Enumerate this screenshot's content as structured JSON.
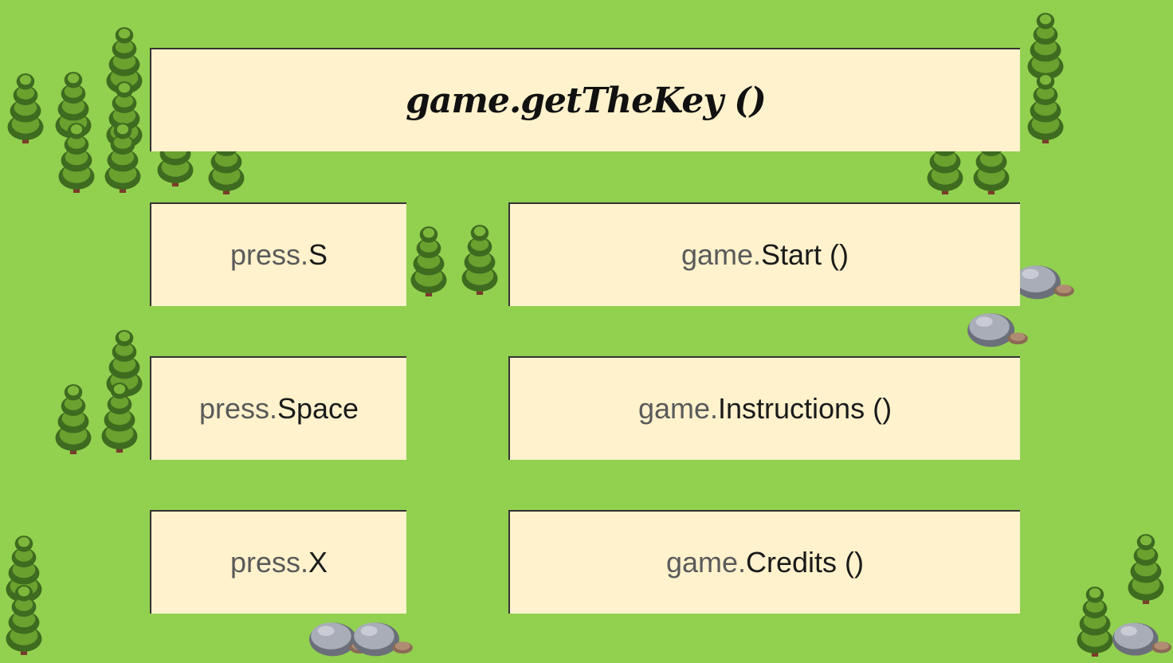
{
  "title": "game.getTheKey ()",
  "menu": [
    {
      "key_prefix": "press.",
      "key": "S",
      "action_prefix": "game.",
      "action": "Start ()"
    },
    {
      "key_prefix": "press.",
      "key": "Space",
      "action_prefix": "game.",
      "action": "Instructions ()"
    },
    {
      "key_prefix": "press.",
      "key": "X",
      "action_prefix": "game.",
      "action": "Credits ()"
    }
  ],
  "colors": {
    "grass": "#92d050",
    "panel": "#fff2cc",
    "tree_dark": "#3e6b1f",
    "tree_light": "#6aa12f",
    "rock": "#a8adb8"
  },
  "decorations": [
    "tree-icon",
    "rock-icon"
  ]
}
